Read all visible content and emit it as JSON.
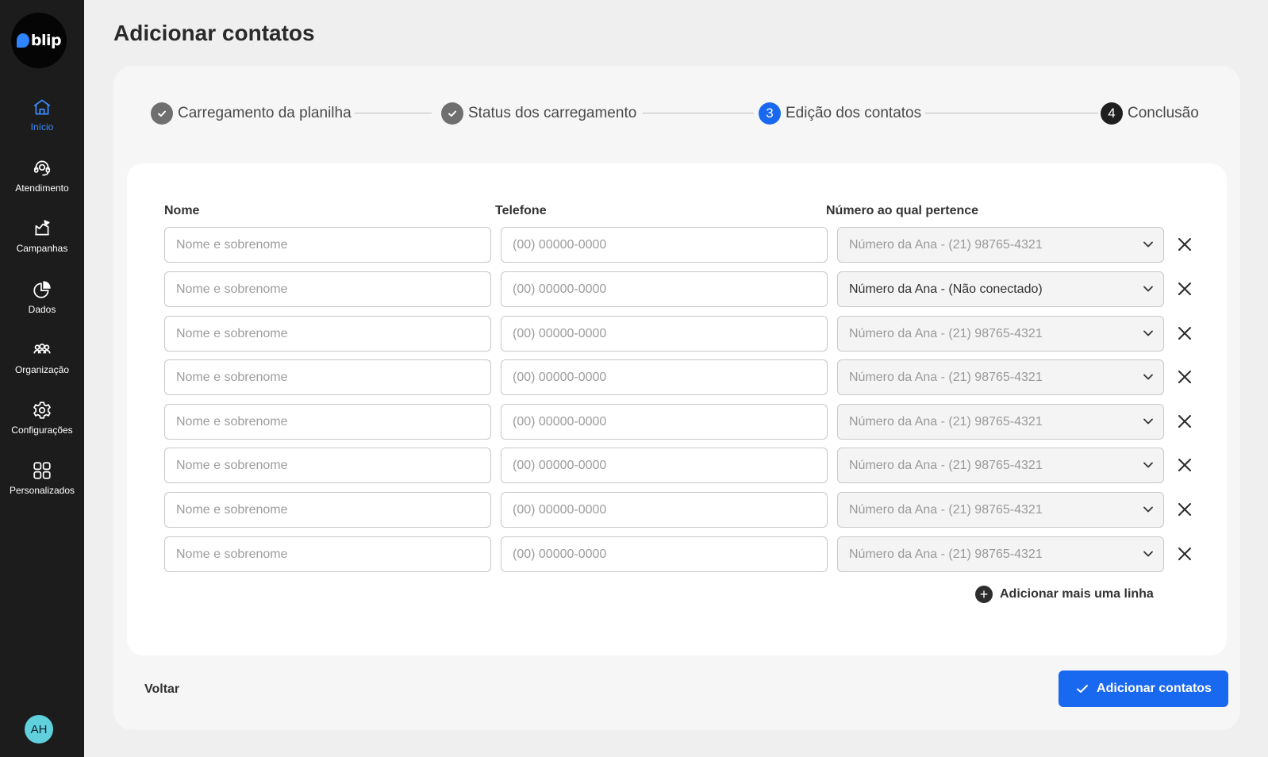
{
  "sidebar": {
    "logo": "blip",
    "items": [
      {
        "label": "Início",
        "icon": "home-icon",
        "active": true
      },
      {
        "label": "Atendimento",
        "icon": "headset-icon"
      },
      {
        "label": "Campanhas",
        "icon": "campaign-icon"
      },
      {
        "label": "Dados",
        "icon": "pie-chart-icon"
      },
      {
        "label": "Organização",
        "icon": "people-icon"
      },
      {
        "label": "Configurações",
        "icon": "gear-icon"
      },
      {
        "label": "Personalizados",
        "icon": "grid-icon"
      }
    ],
    "avatar": "AH"
  },
  "page": {
    "title": "Adicionar contatos"
  },
  "stepper": {
    "steps": [
      {
        "label": "Carregamento da planilha",
        "marker": "",
        "state": "done"
      },
      {
        "label": "Status dos carregamento",
        "marker": "",
        "state": "done"
      },
      {
        "label": "Edição dos contatos",
        "marker": "3",
        "state": "current"
      },
      {
        "label": "Conclusão",
        "marker": "4",
        "state": "pending"
      }
    ]
  },
  "table": {
    "headers": {
      "name": "Nome",
      "phone": "Telefone",
      "number": "Número ao qual pertence"
    },
    "name_placeholder": "Nome e sobrenome",
    "phone_placeholder": "(00) 00000-0000",
    "rows": [
      {
        "name": "",
        "phone": "",
        "number": "Número da Ana - (21) 98765-4321",
        "number_selected": false
      },
      {
        "name": "",
        "phone": "",
        "number": "Número da Ana - (Não conectado)",
        "number_selected": true
      },
      {
        "name": "",
        "phone": "",
        "number": "Número da Ana - (21) 98765-4321",
        "number_selected": false
      },
      {
        "name": "",
        "phone": "",
        "number": "Número da Ana - (21) 98765-4321",
        "number_selected": false
      },
      {
        "name": "",
        "phone": "",
        "number": "Número da Ana - (21) 98765-4321",
        "number_selected": false
      },
      {
        "name": "",
        "phone": "",
        "number": "Número da Ana - (21) 98765-4321",
        "number_selected": false
      },
      {
        "name": "",
        "phone": "",
        "number": "Número da Ana - (21) 98765-4321",
        "number_selected": false
      },
      {
        "name": "",
        "phone": "",
        "number": "Número da Ana - (21) 98765-4321",
        "number_selected": false
      }
    ],
    "add_line": "Adicionar mais uma linha"
  },
  "footer": {
    "back": "Voltar",
    "submit": "Adicionar contatos"
  },
  "colors": {
    "primary": "#1968f0",
    "sidebar": "#1c1c1c",
    "active_nav": "#3d8bff",
    "done_step": "#6f6f6f",
    "avatar": "#5fd0dc"
  }
}
